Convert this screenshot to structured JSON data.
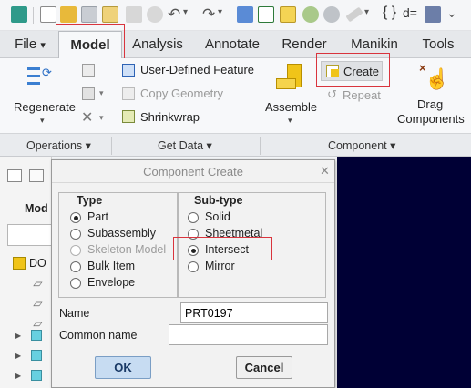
{
  "tabs": [
    {
      "label": "File",
      "suffix": "▾"
    },
    {
      "label": "Model"
    },
    {
      "label": "Analysis"
    },
    {
      "label": "Annotate"
    },
    {
      "label": "Render"
    },
    {
      "label": "Manikin"
    },
    {
      "label": "Tools"
    }
  ],
  "ribbon": {
    "regenerate": "Regenerate",
    "user_defined_feature": "User-Defined Feature",
    "copy_geometry": "Copy Geometry",
    "shrinkwrap": "Shrinkwrap",
    "assemble": "Assemble",
    "create": "Create",
    "repeat": "Repeat",
    "drag_components_line1": "Drag",
    "drag_components_line2": "Components"
  },
  "groups": {
    "operations": "Operations ▾",
    "get_data": "Get Data ▾",
    "component": "Component ▾"
  },
  "left_pane": {
    "tree_header": "Mod",
    "root_item": "DO"
  },
  "dialog": {
    "title": "Component Create",
    "type_header": "Type",
    "type_options": [
      "Part",
      "Subassembly",
      "Skeleton Model",
      "Bulk Item",
      "Envelope"
    ],
    "subtype_header": "Sub-type",
    "subtype_options": [
      "Solid",
      "Sheetmetal",
      "Intersect",
      "Mirror"
    ],
    "name_label": "Name",
    "name_value": "PRT0197",
    "common_name_label": "Common name",
    "common_name_value": "",
    "ok": "OK",
    "cancel": "Cancel"
  },
  "colors": {
    "highlight_box": "#d9343d",
    "viewport": "#000035"
  }
}
